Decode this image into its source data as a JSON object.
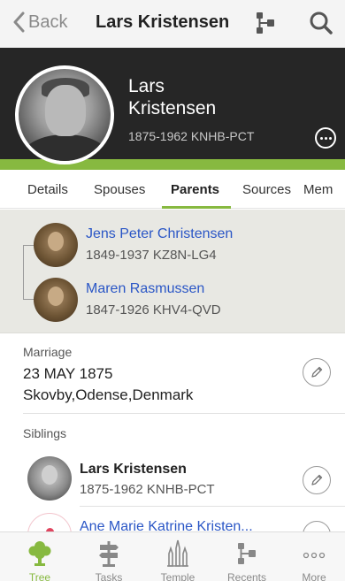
{
  "nav": {
    "back_label": "Back",
    "title": "Lars Kristensen"
  },
  "header": {
    "first_name": "Lars",
    "last_name": "Kristensen",
    "info": "1875-1962  KNHB-PCT"
  },
  "tabs": [
    {
      "label": "Details"
    },
    {
      "label": "Spouses"
    },
    {
      "label": "Parents"
    },
    {
      "label": "Sources"
    },
    {
      "label": "Mem"
    }
  ],
  "parents": [
    {
      "name": "Jens Peter Christensen",
      "info": "1849-1937   KZ8N-LG4"
    },
    {
      "name": "Maren Rasmussen",
      "info": "1847-1926   KHV4-QVD"
    }
  ],
  "marriage": {
    "label": "Marriage",
    "date": "23 MAY 1875",
    "place": "Skovby,Odense,Denmark"
  },
  "siblings": {
    "label": "Siblings",
    "items": [
      {
        "name": "Lars Kristensen",
        "info": "1875-1962   KNHB-PCT"
      },
      {
        "name": "Ane Marie Katrine Kristen..."
      }
    ]
  },
  "tabbar": [
    {
      "label": "Tree"
    },
    {
      "label": "Tasks"
    },
    {
      "label": "Temple"
    },
    {
      "label": "Recents"
    },
    {
      "label": "More"
    }
  ],
  "colors": {
    "accent": "#87b940",
    "link": "#2a56c6",
    "header_bg": "#262626"
  }
}
